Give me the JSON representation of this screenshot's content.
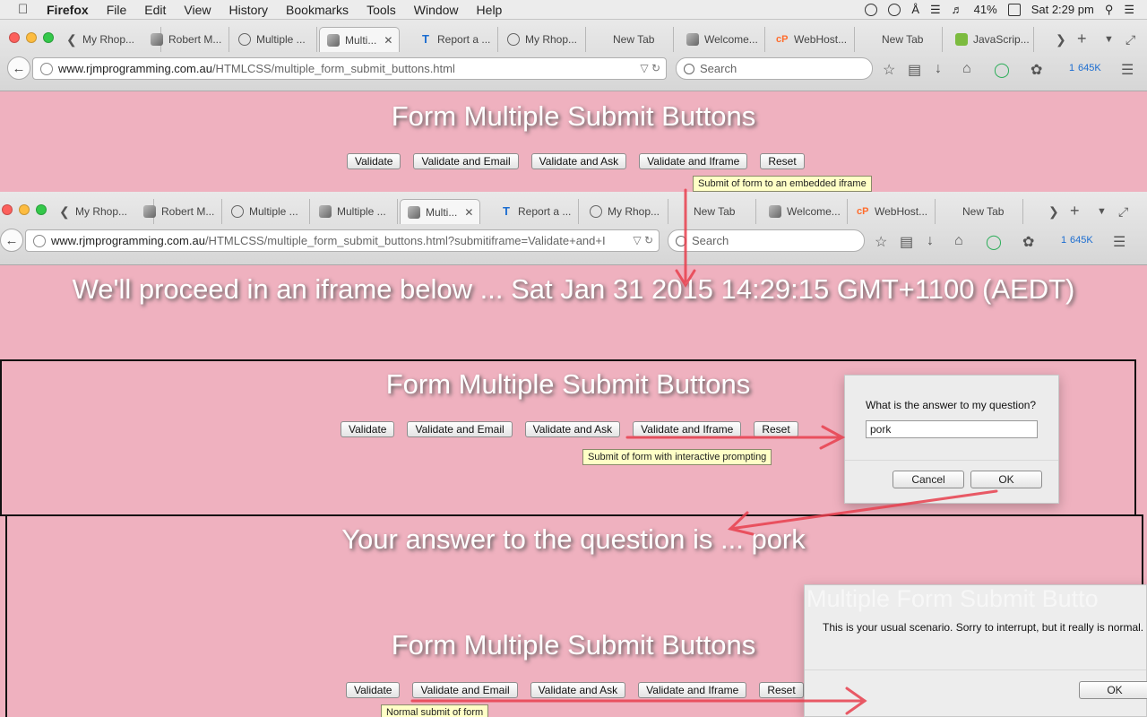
{
  "menubar": {
    "app": "Firefox",
    "items": [
      "File",
      "Edit",
      "View",
      "History",
      "Bookmarks",
      "Tools",
      "Window",
      "Help"
    ],
    "battery": "41%",
    "clock": "Sat 2:29 pm"
  },
  "browser1": {
    "tabs": [
      "My Rhop...",
      "Robert M...",
      "Multiple ...",
      "Multi...",
      "Report a ...",
      "My Rhop...",
      "New Tab",
      "Welcome...",
      "WebHost...",
      "New Tab",
      "JavaScrip..."
    ],
    "url_domain": "www.rjmprogramming.com.au",
    "url_path": "/HTMLCSS/multiple_form_submit_buttons.html",
    "search_placeholder": "Search",
    "badge_count": "1",
    "badge_size": "645K"
  },
  "browser2": {
    "tabs": [
      "My Rhop...",
      "Robert M...",
      "Multiple ...",
      "Multiple ...",
      "Multi...",
      "Report a ...",
      "My Rhop...",
      "New Tab",
      "Welcome...",
      "WebHost...",
      "New Tab"
    ],
    "url_domain": "www.rjmprogramming.com.au",
    "url_path": "/HTMLCSS/multiple_form_submit_buttons.html?submitiframe=Validate+and+I",
    "search_placeholder": "Search",
    "badge_count": "1",
    "badge_size": "645K"
  },
  "form": {
    "title": "Form Multiple Submit Buttons",
    "buttons": [
      "Validate",
      "Validate and Email",
      "Validate and Ask",
      "Validate and Iframe",
      "Reset"
    ]
  },
  "tooltips": {
    "iframe": "Submit of form to an embedded iframe",
    "ask": "Submit of form with interactive prompting",
    "normal": "Normal submit of form"
  },
  "proceed_text": "We'll proceed in an iframe below ... Sat Jan 31 2015 14:29:15 GMT+1100 (AEDT)",
  "answer_text": "Your answer to the question is ... pork",
  "prompt_dialog": {
    "question": "What is the answer to my question?",
    "value": "pork",
    "cancel": "Cancel",
    "ok": "OK"
  },
  "alert_dialog": {
    "message": "This is your usual scenario.  Sorry to interrupt, but it really is normal.",
    "ok": "OK",
    "ghost_title": "Multiple Form Submit Butto"
  },
  "colors": {
    "page_bg": "#efb1bf",
    "arrow": "#e8404e",
    "tooltip_bg": "#ffffc6"
  }
}
